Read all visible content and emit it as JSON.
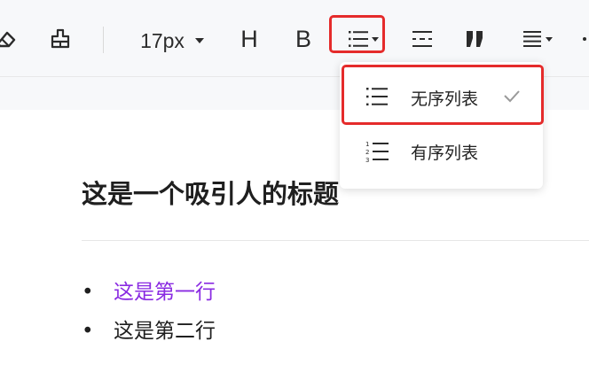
{
  "toolbar": {
    "font_size": "17px",
    "heading_label": "H",
    "bold_label": "B"
  },
  "dropdown": {
    "items": [
      {
        "label": "无序列表",
        "selected": true
      },
      {
        "label": "有序列表",
        "selected": false
      }
    ]
  },
  "document": {
    "title": "这是一个吸引人的标题",
    "list": [
      {
        "text": "这是第一行",
        "color": "#8a2be2"
      },
      {
        "text": "这是第二行",
        "color": "#1f1f1f"
      }
    ]
  },
  "colors": {
    "highlight": "#e52b2b",
    "toolbar_bg": "#f7f8fa"
  }
}
